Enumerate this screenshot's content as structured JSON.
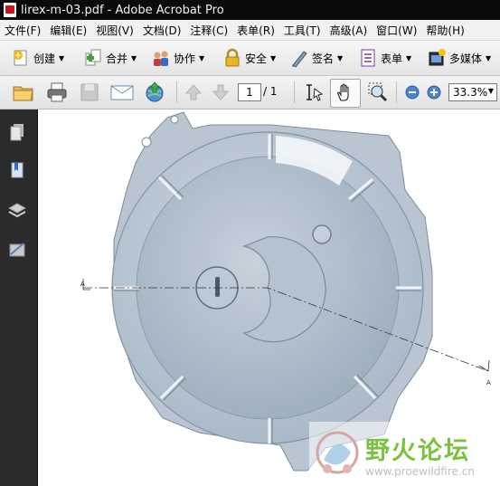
{
  "window": {
    "title": "lirex-m-03.pdf - Adobe Acrobat Pro"
  },
  "menu": [
    "文件(F)",
    "编辑(E)",
    "视图(V)",
    "文档(D)",
    "注释(C)",
    "表单(R)",
    "工具(T)",
    "高级(A)",
    "窗口(W)",
    "帮助(H)"
  ],
  "tasks": {
    "create": "创建",
    "combine": "合并",
    "collaborate": "协作",
    "secure": "安全",
    "sign": "签名",
    "forms": "表单",
    "multimedia": "多媒体"
  },
  "navigation": {
    "page_current": "1",
    "page_total": "/ 1",
    "zoom": "33.3%"
  },
  "drawing": {
    "marker_left": "A",
    "marker_right": "A"
  },
  "watermark": {
    "name": "野火论坛",
    "url": "www.proewildfire.cn"
  },
  "colors": {
    "part_fill": "#b9c6d2",
    "accent_blue": "#2f6fd1",
    "watermark_green": "#7bc142"
  }
}
